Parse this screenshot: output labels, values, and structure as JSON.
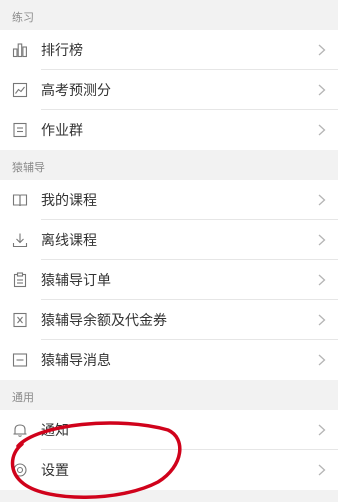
{
  "sections": [
    {
      "title": "练习",
      "items": [
        {
          "label": "排行榜",
          "icon": "bar-chart-icon"
        },
        {
          "label": "高考预测分",
          "icon": "chart-picture-icon"
        },
        {
          "label": "作业群",
          "icon": "list-doc-icon"
        }
      ]
    },
    {
      "title": "猿辅导",
      "items": [
        {
          "label": "我的课程",
          "icon": "book-icon"
        },
        {
          "label": "离线课程",
          "icon": "download-icon"
        },
        {
          "label": "猿辅导订单",
          "icon": "clipboard-icon"
        },
        {
          "label": "猿辅导余额及代金券",
          "icon": "coupon-icon"
        },
        {
          "label": "猿辅导消息",
          "icon": "message-icon"
        }
      ]
    },
    {
      "title": "通用",
      "items": [
        {
          "label": "通知",
          "icon": "bell-icon"
        },
        {
          "label": "设置",
          "icon": "gear-icon"
        }
      ]
    }
  ],
  "annotation": {
    "color": "#d0021b"
  }
}
